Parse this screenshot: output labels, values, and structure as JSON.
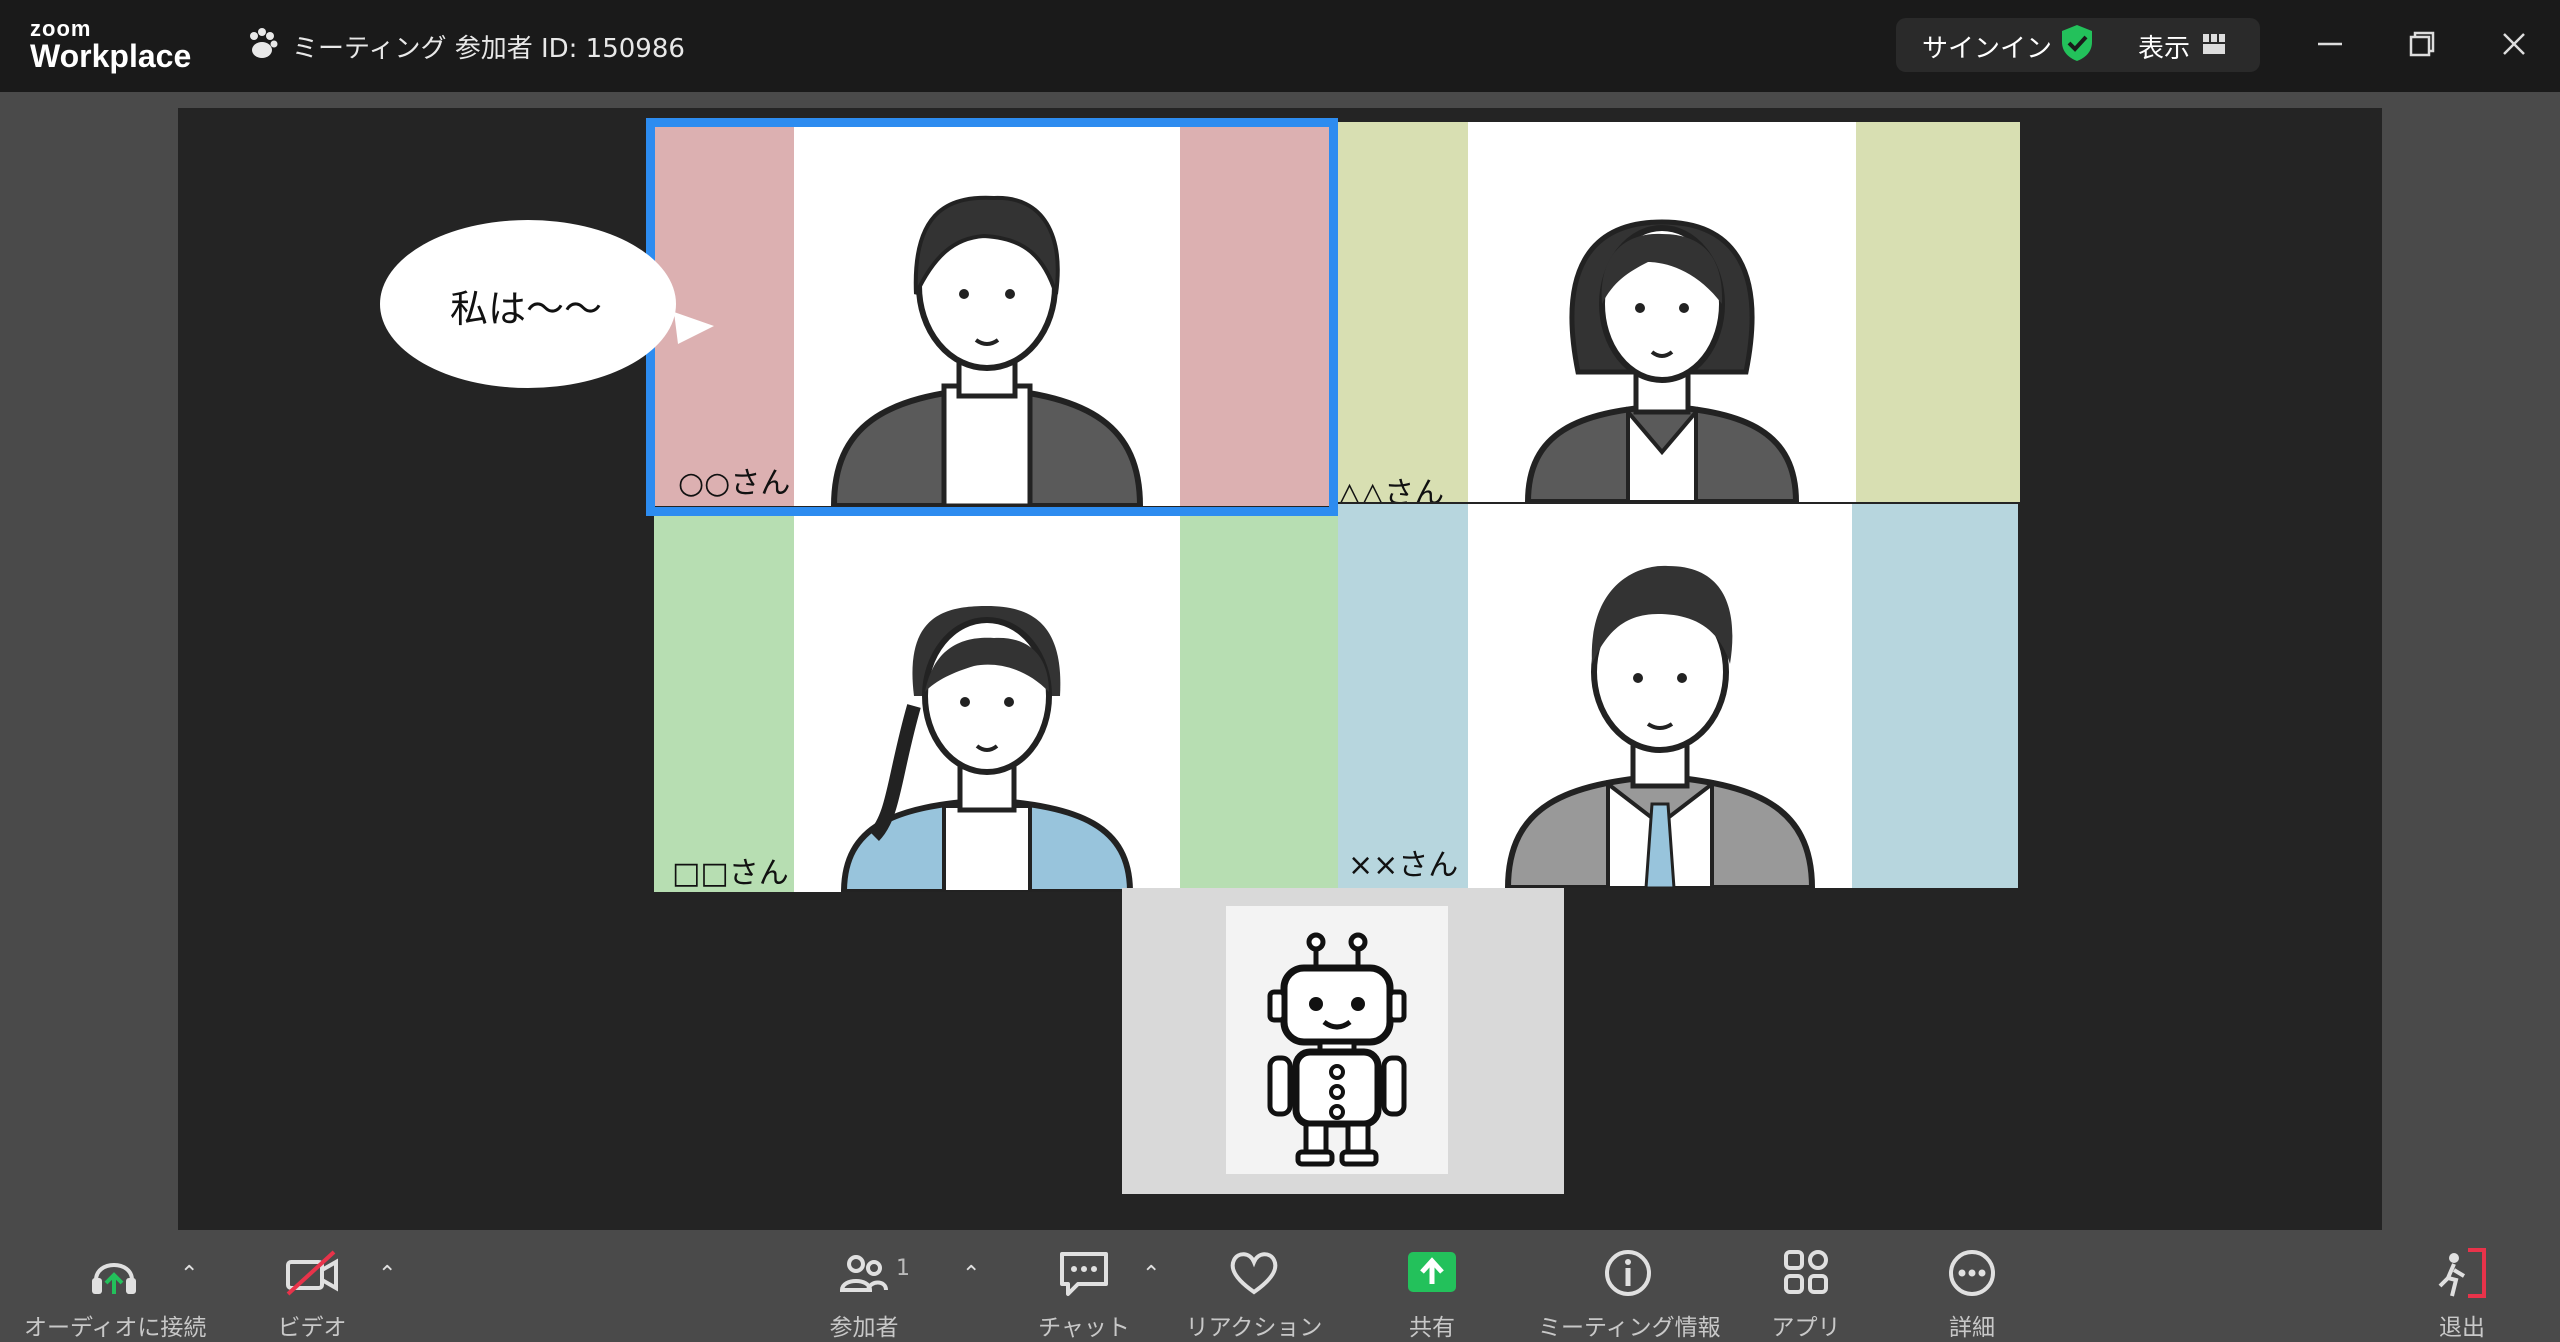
{
  "app": {
    "logo_top": "zoom",
    "logo_bottom": "Workplace",
    "meeting_title": "ミーティング 参加者 ID: 150986"
  },
  "titlebar": {
    "signin": "サインイン",
    "view": "表示"
  },
  "participants": [
    {
      "name": "○○さん",
      "bg": "#dcb0b1",
      "speaking": true
    },
    {
      "name": "△△さん",
      "bg": "#d8dfb2"
    },
    {
      "name": "□□さん",
      "bg": "#b7deb2"
    },
    {
      "name": "××さん",
      "bg": "#b7d6de"
    }
  ],
  "speech_bubble": "私は〜〜",
  "toolbar": {
    "audio": "オーディオに接続",
    "video": "ビデオ",
    "participants": "参加者",
    "participants_count": "1",
    "chat": "チャット",
    "reaction": "リアクション",
    "share": "共有",
    "meeting_info": "ミーティング情報",
    "apps": "アプリ",
    "more": "詳細",
    "leave": "退出"
  },
  "colors": {
    "accent": "#2d8cf0",
    "share_green": "#23c15b",
    "leave_red": "#e8334a"
  }
}
